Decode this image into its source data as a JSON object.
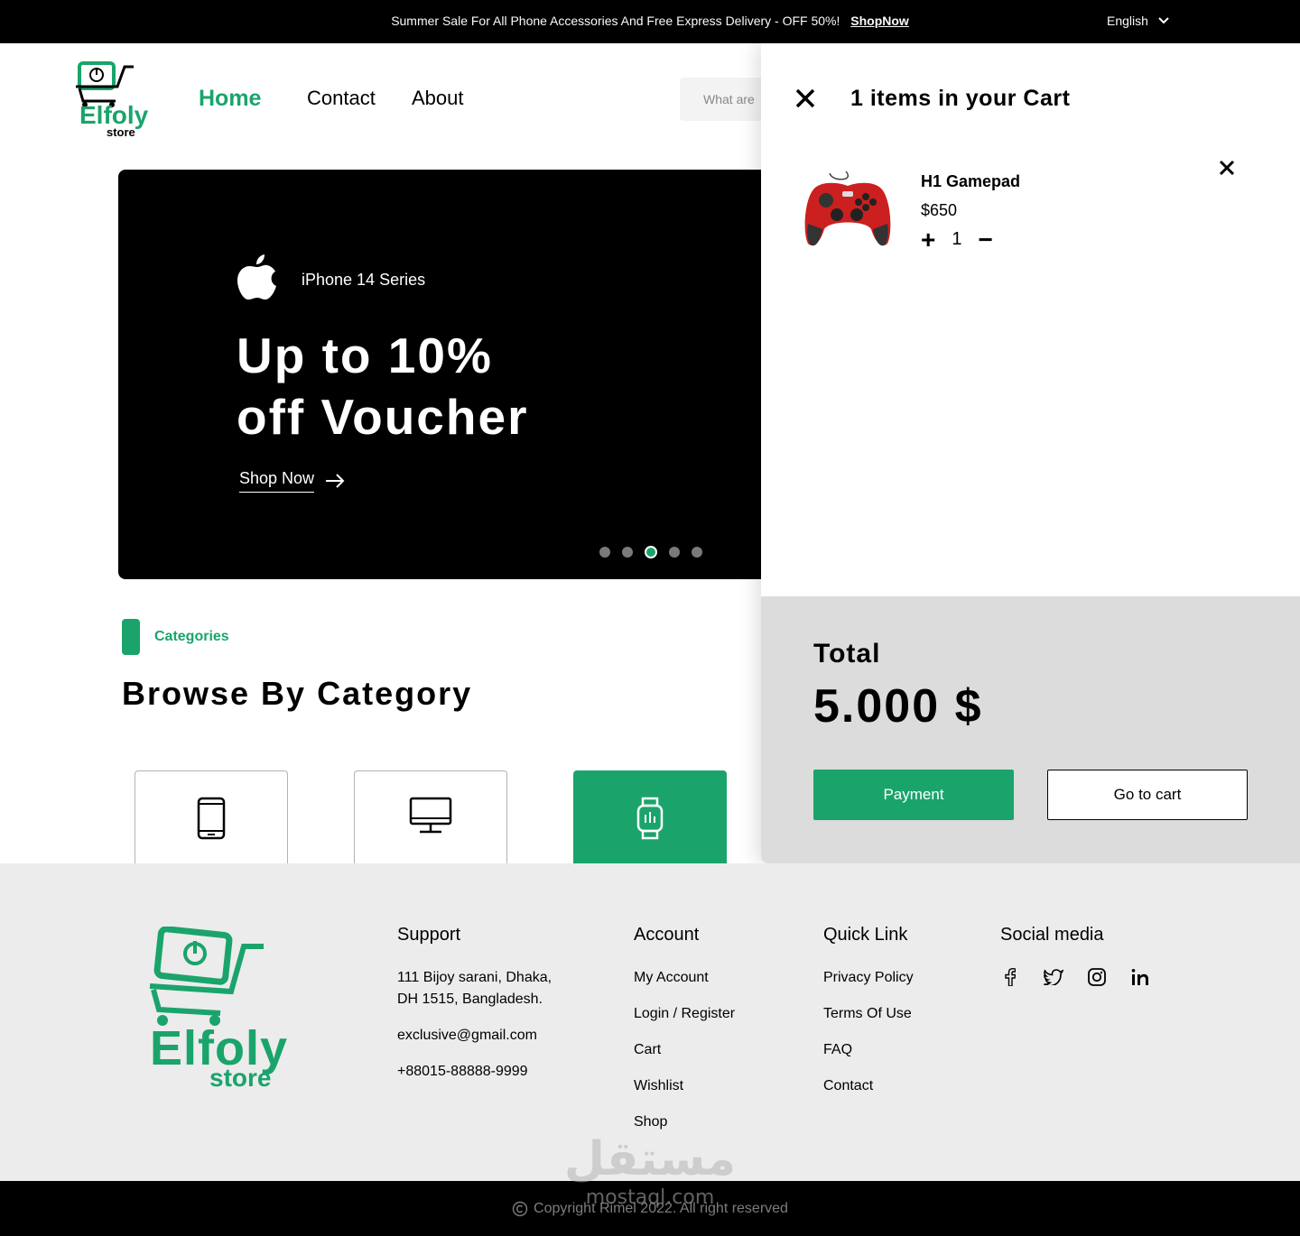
{
  "topbar": {
    "promo": "Summer Sale For All Phone Accessories And Free Express Delivery - OFF 50%!",
    "shop_link": "ShopNow",
    "language": "English"
  },
  "logo": {
    "name": "Elfoly",
    "sub": "store"
  },
  "nav": {
    "home": "Home",
    "contact": "Contact",
    "about": "About"
  },
  "search": {
    "placeholder": "What are"
  },
  "hero": {
    "series": "iPhone 14 Series",
    "headline_1": "Up to 10%",
    "headline_2": "off Voucher",
    "cta": "Shop Now",
    "slide_count": 5,
    "active_slide": 3
  },
  "categories": {
    "label": "Categories",
    "title": "Browse By Category",
    "cards": [
      {
        "icon": "phone-icon",
        "active": false
      },
      {
        "icon": "computer-icon",
        "active": false
      },
      {
        "icon": "smartwatch-icon",
        "active": true
      }
    ]
  },
  "cart": {
    "title": "1 items in your Cart",
    "item": {
      "name": "H1 Gamepad",
      "price": "$650",
      "quantity": "1",
      "plus": "+",
      "minus": "−"
    },
    "total_label": "Total",
    "total_value": "5.000 $",
    "payment_label": "Payment",
    "goto_label": "Go to cart"
  },
  "footer": {
    "support": {
      "title": "Support",
      "address_1": "111 Bijoy sarani, Dhaka,",
      "address_2": "DH 1515, Bangladesh.",
      "email": "exclusive@gmail.com",
      "phone": "+88015-88888-9999"
    },
    "account": {
      "title": "Account",
      "links": [
        "My Account",
        "Login / Register",
        "Cart",
        "Wishlist",
        "Shop"
      ]
    },
    "quick_link": {
      "title": "Quick Link",
      "links": [
        "Privacy Policy",
        "Terms Of Use",
        "FAQ",
        "Contact"
      ]
    },
    "social": {
      "title": "Social media",
      "icons": [
        "facebook-icon",
        "twitter-icon",
        "instagram-icon",
        "linkedin-icon"
      ]
    }
  },
  "copyright": "Copyright Rimel 2022. All right reserved",
  "watermark": {
    "arabic": "مستقل",
    "latin": "mostaql.com"
  },
  "colors": {
    "accent": "#1aa46b",
    "dark": "#000000",
    "panel": "#dcdcdc",
    "footer": "#ececec"
  }
}
